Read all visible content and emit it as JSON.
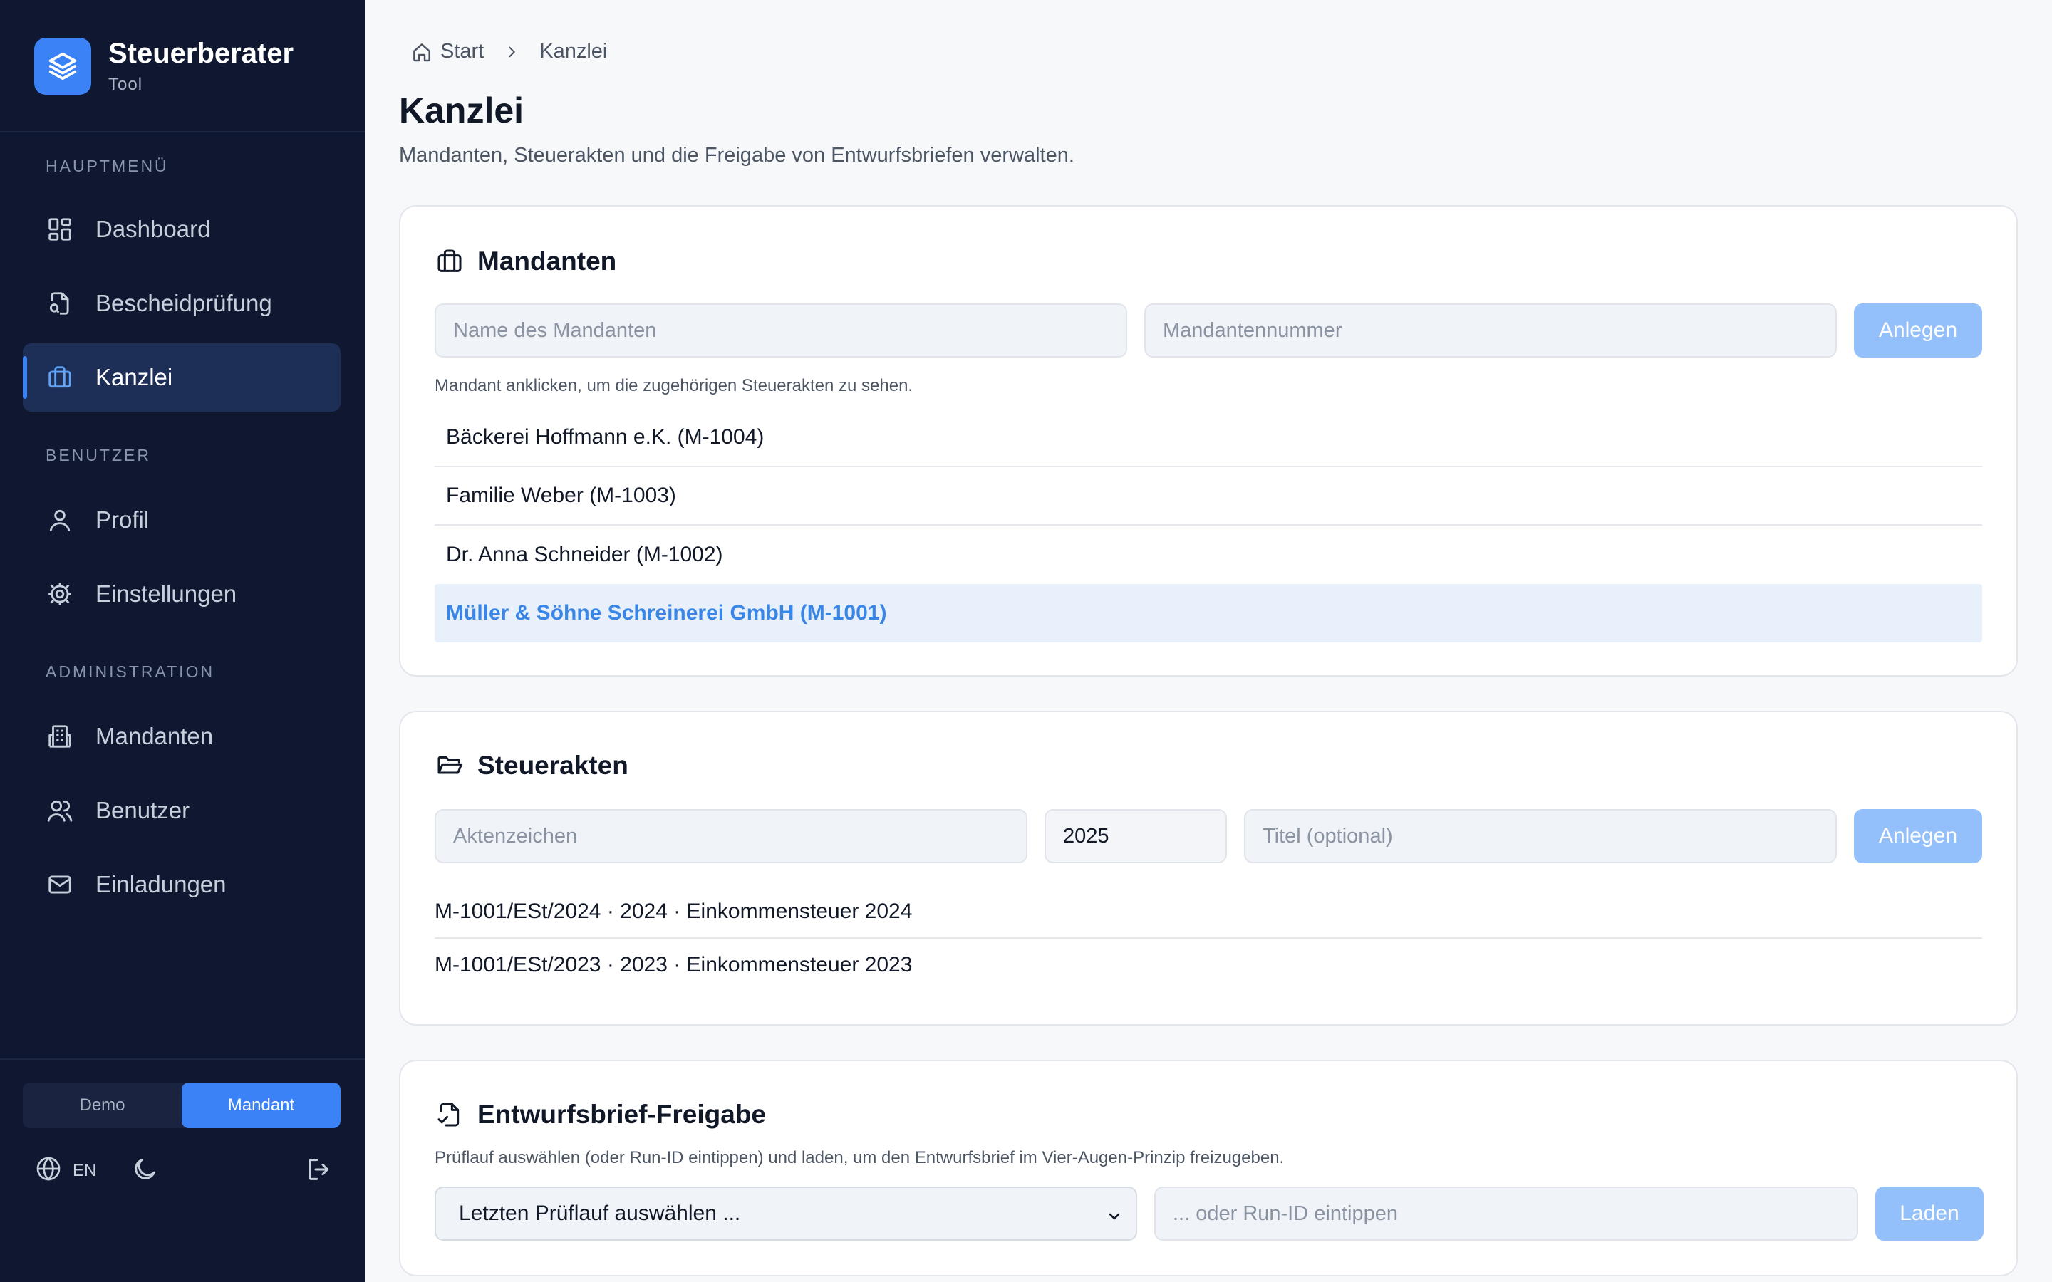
{
  "brand": {
    "title": "Steuerberater",
    "subtitle": "Tool",
    "accent": "#3b82f6"
  },
  "nav": {
    "sections": {
      "main": "HAUPTMENÜ",
      "user": "BENUTZER",
      "admin": "ADMINISTRATION"
    },
    "items": {
      "dashboard": "Dashboard",
      "bescheid": "Bescheidprüfung",
      "kanzlei": "Kanzlei",
      "profil": "Profil",
      "einstellungen": "Einstellungen",
      "mandanten": "Mandanten",
      "benutzer": "Benutzer",
      "einladungen": "Einladungen"
    },
    "active": "kanzlei"
  },
  "footer": {
    "mode_demo": "Demo",
    "mode_mandant": "Mandant",
    "mode_active": "Mandant",
    "language": "EN"
  },
  "breadcrumb": {
    "home": "Start",
    "current": "Kanzlei"
  },
  "page": {
    "title": "Kanzlei",
    "subtitle": "Mandanten, Steuerakten und die Freigabe von Entwurfsbriefen verwalten."
  },
  "mandanten": {
    "title": "Mandanten",
    "name_placeholder": "Name des Mandanten",
    "number_placeholder": "Mandantennummer",
    "create_label": "Anlegen",
    "hint": "Mandant anklicken, um die zugehörigen Steuerakten zu sehen.",
    "clients": [
      "Bäckerei Hoffmann e.K. (M-1004)",
      "Familie Weber (M-1003)",
      "Dr. Anna Schneider (M-1002)",
      "Müller & Söhne Schreinerei GmbH (M-1001)"
    ],
    "selected_index": 3
  },
  "steuerakten": {
    "title": "Steuerakten",
    "aktenzeichen_placeholder": "Aktenzeichen",
    "year_value": "2025",
    "title_placeholder": "Titel (optional)",
    "create_label": "Anlegen",
    "files": [
      "M-1001/ESt/2024 · 2024 · Einkommensteuer 2024",
      "M-1001/ESt/2023 · 2023 · Einkommensteuer 2023"
    ]
  },
  "freigabe": {
    "title": "Entwurfsbrief-Freigabe",
    "hint": "Prüflauf auswählen (oder Run-ID eintippen) und laden, um den Entwurfsbrief im Vier-Augen-Prinzip freizugeben.",
    "select_value": "Letzten Prüflauf auswählen ...",
    "runid_placeholder": "... oder Run-ID eintippen",
    "load_label": "Laden"
  }
}
